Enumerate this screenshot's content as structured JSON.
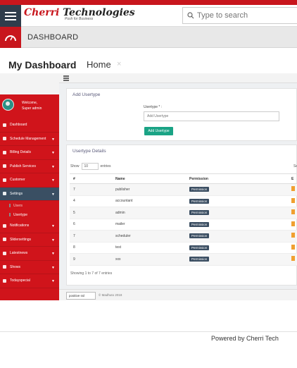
{
  "brand": {
    "name_first": "Cherri",
    "name_rest": "Technologies",
    "tagline": "Push for Business",
    "accent": "#c8161d",
    "dark": "#2f3d4c"
  },
  "search": {
    "placeholder": "Type to search"
  },
  "dashbar": {
    "title": "DASHBOARD"
  },
  "tabs": [
    {
      "label": "My Dashboard"
    },
    {
      "label": "Home",
      "close": "×"
    }
  ],
  "sidebar": {
    "welcome": "Welcome,",
    "user": "Super admin",
    "items": [
      {
        "label": "Dashboard",
        "chevron": false
      },
      {
        "label": "Schedule Management",
        "chevron": true
      },
      {
        "label": "Billing Details",
        "chevron": true
      },
      {
        "label": "Publish Services",
        "chevron": true
      },
      {
        "label": "Customer",
        "chevron": true
      },
      {
        "label": "Settings",
        "chevron": true,
        "active": true
      }
    ],
    "subitems": [
      {
        "label": "Users"
      },
      {
        "label": "Usertype",
        "selected": true
      }
    ],
    "items_after": [
      {
        "label": "Notifications"
      },
      {
        "label": "Slidersettings"
      },
      {
        "label": "Latestnews"
      },
      {
        "label": "Shows"
      },
      {
        "label": "Todayspecial"
      }
    ]
  },
  "add_panel": {
    "title": "Add Usertype",
    "field_label": "Usertype * :",
    "field_placeholder": "Add Usertype",
    "button": "Add Usertype"
  },
  "details_panel": {
    "title": "Usertype Details",
    "show_label": "Show",
    "show_value": "10",
    "entries_label": "entries",
    "search_label": "Se",
    "columns": [
      "#",
      "Name",
      "Permission",
      "E"
    ],
    "rows": [
      {
        "num": "7",
        "name": "publisher",
        "perm": "Permission"
      },
      {
        "num": "4",
        "name": "accountant",
        "perm": "Permission"
      },
      {
        "num": "5",
        "name": "admin",
        "perm": "Permission"
      },
      {
        "num": "6",
        "name": "mailer",
        "perm": "Permission"
      },
      {
        "num": "7",
        "name": "scheduler",
        "perm": "Permission"
      },
      {
        "num": "8",
        "name": "test",
        "perm": "Permission"
      },
      {
        "num": "9",
        "name": "xxx",
        "perm": "Permission"
      }
    ],
    "showing": "Showing 1 to 7 of 7 entries"
  },
  "inner_footer": {
    "ssl": "positive ssl",
    "copyright": "©   Madhuto 2018"
  },
  "footer": {
    "powered": "Powered by Cherri Tech"
  }
}
